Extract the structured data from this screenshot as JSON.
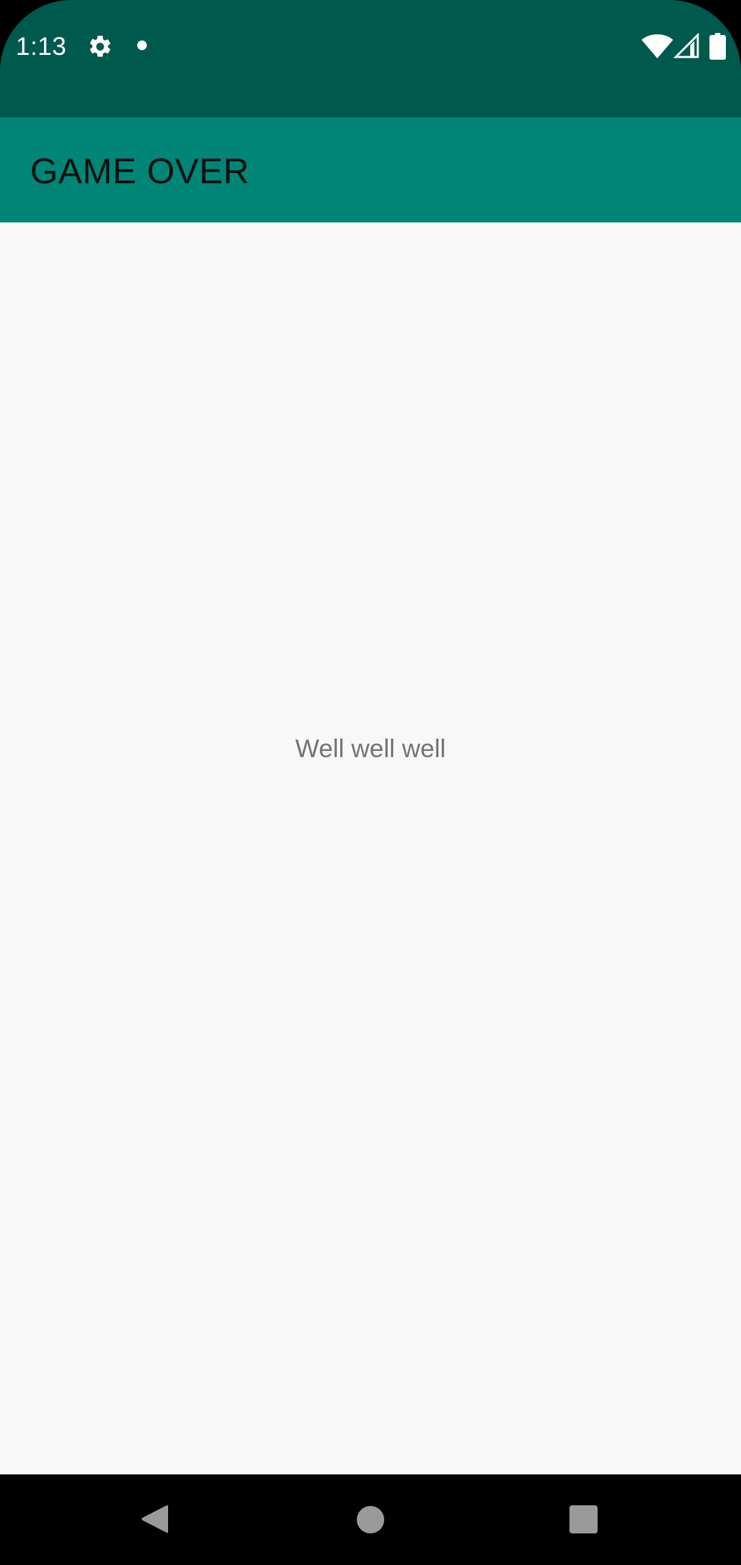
{
  "status_bar": {
    "time": "1:13",
    "icons": [
      "gear-icon",
      "notification-dot-icon",
      "wifi-icon",
      "cell-signal-icon",
      "battery-icon"
    ]
  },
  "app_bar": {
    "title": "GAME OVER"
  },
  "main": {
    "message": "Well well well"
  },
  "nav_bar": {
    "icons": [
      "back-icon",
      "home-icon",
      "recents-icon"
    ]
  },
  "colors": {
    "status_bar": "#00594d",
    "app_bar": "#008577",
    "background": "#f8f8f8",
    "message_text": "#737373",
    "title_text": "#111111"
  }
}
